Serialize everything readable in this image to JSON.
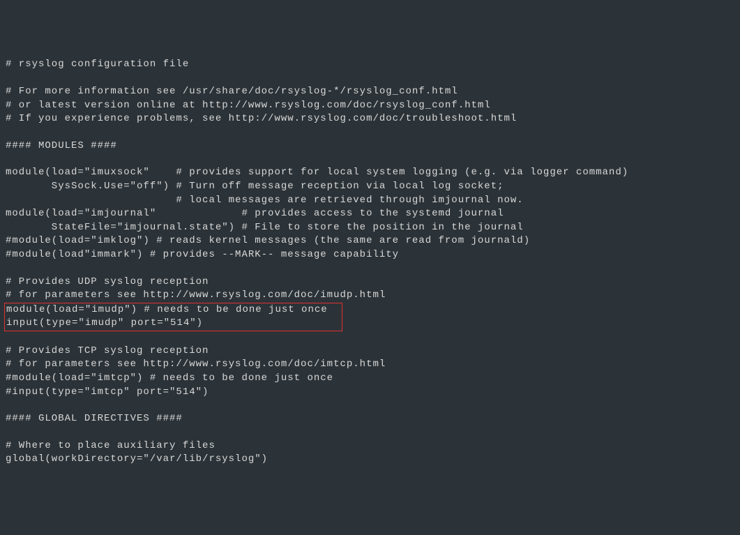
{
  "lines": [
    "# rsyslog configuration file",
    "",
    "# For more information see /usr/share/doc/rsyslog-*/rsyslog_conf.html",
    "# or latest version online at http://www.rsyslog.com/doc/rsyslog_conf.html",
    "# If you experience problems, see http://www.rsyslog.com/doc/troubleshoot.html",
    "",
    "#### MODULES ####",
    "",
    "module(load=\"imuxsock\"    # provides support for local system logging (e.g. via logger command)",
    "       SysSock.Use=\"off\") # Turn off message reception via local log socket;",
    "                          # local messages are retrieved through imjournal now.",
    "module(load=\"imjournal\"             # provides access to the systemd journal",
    "       StateFile=\"imjournal.state\") # File to store the position in the journal",
    "#module(load=\"imklog\") # reads kernel messages (the same are read from journald)",
    "#module(load\"immark\") # provides --MARK-- message capability",
    "",
    "# Provides UDP syslog reception",
    "# for parameters see http://www.rsyslog.com/doc/imudp.html"
  ],
  "highlighted": [
    "module(load=\"imudp\") # needs to be done just once",
    "input(type=\"imudp\" port=\"514\")                     "
  ],
  "lines_after": [
    "",
    "# Provides TCP syslog reception",
    "# for parameters see http://www.rsyslog.com/doc/imtcp.html",
    "#module(load=\"imtcp\") # needs to be done just once",
    "#input(type=\"imtcp\" port=\"514\")",
    "",
    "#### GLOBAL DIRECTIVES ####",
    "",
    "# Where to place auxiliary files",
    "global(workDirectory=\"/var/lib/rsyslog\")"
  ]
}
